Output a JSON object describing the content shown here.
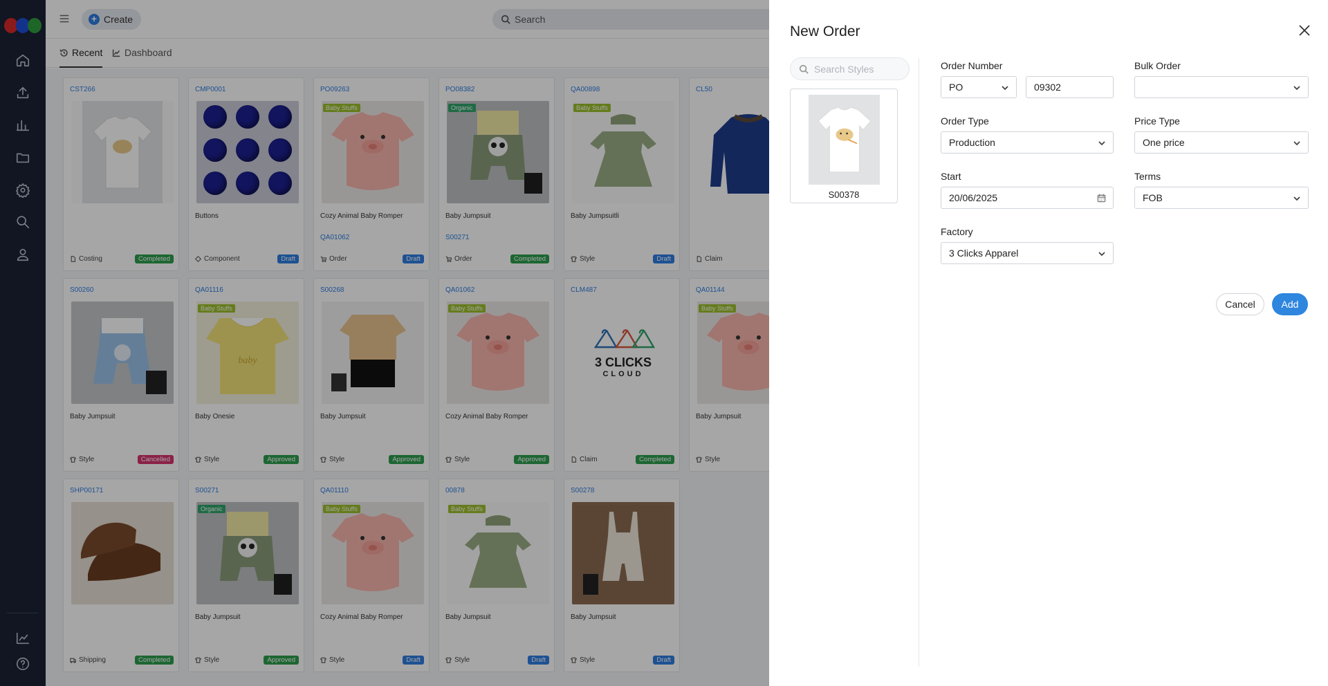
{
  "app": {
    "create_label": "Create",
    "search_placeholder": "Search"
  },
  "tabs": [
    {
      "label": "Recent",
      "icon": "history-icon"
    },
    {
      "label": "Dashboard",
      "icon": "chart-icon"
    }
  ],
  "cards": [
    {
      "code": "CST266",
      "name": "",
      "link": "",
      "type": "Costing",
      "type_icon": "file-icon",
      "status": "Completed",
      "status_color": "#2d9d4d",
      "tag": "",
      "image": "tshirt"
    },
    {
      "code": "CMP0001",
      "name": "Buttons",
      "link": "",
      "type": "Component",
      "type_icon": "diamond-icon",
      "status": "Draft",
      "status_color": "#2e7de0",
      "tag": "",
      "image": "buttons"
    },
    {
      "code": "PO09263",
      "name": "Cozy Animal Baby Romper",
      "link": "QA01062",
      "type": "Order",
      "type_icon": "cart-icon",
      "status": "Draft",
      "status_color": "#2e7de0",
      "tag": "Baby Stuffs",
      "tag_color": "#9bbf2b",
      "image": "pig"
    },
    {
      "code": "PO08382",
      "name": "Baby Jumpsuit",
      "link": "S00271",
      "type": "Order",
      "type_icon": "cart-icon",
      "status": "Completed",
      "status_color": "#2d9d4d",
      "tag": "Organic",
      "tag_color": "#2fa36b",
      "image": "panda"
    },
    {
      "code": "QA00898",
      "name": "Baby Jumpsuitli",
      "link": "",
      "type": "Style",
      "type_icon": "shirt-icon",
      "status": "Draft",
      "status_color": "#2e7de0",
      "tag": "Baby Stuffs",
      "tag_color": "#9bbf2b",
      "image": "dress"
    },
    {
      "code": "CL50",
      "name": "",
      "link": "",
      "type": "Claim",
      "type_icon": "file-icon",
      "status": "",
      "status_color": "",
      "tag": "",
      "image": "jacket"
    },
    {
      "code": "S00260",
      "name": "Baby Jumpsuit",
      "link": "",
      "type": "Style",
      "type_icon": "shirt-icon",
      "status": "Cancelled",
      "status_color": "#d6336c",
      "tag": "",
      "image": "blue"
    },
    {
      "code": "QA01116",
      "name": "Baby Onesie",
      "link": "",
      "type": "Style",
      "type_icon": "shirt-icon",
      "status": "Approved",
      "status_color": "#2d9d4d",
      "tag": "Baby Stuffs",
      "tag_color": "#9bbf2b",
      "image": "yellow"
    },
    {
      "code": "S00268",
      "name": "Baby Jumpsuit",
      "link": "",
      "type": "Style",
      "type_icon": "shirt-icon",
      "status": "Approved",
      "status_color": "#2d9d4d",
      "tag": "",
      "image": "dino"
    },
    {
      "code": "QA01062",
      "name": "Cozy Animal Baby Romper",
      "link": "",
      "type": "Style",
      "type_icon": "shirt-icon",
      "status": "Approved",
      "status_color": "#2d9d4d",
      "tag": "Baby Stuffs",
      "tag_color": "#9bbf2b",
      "image": "pig"
    },
    {
      "code": "CLM487",
      "name": "",
      "link": "",
      "type": "Claim",
      "type_icon": "file-icon",
      "status": "Completed",
      "status_color": "#2d9d4d",
      "tag": "",
      "image": "logo",
      "logo_text1": "3 CLICKS",
      "logo_text2": "CLOUD"
    },
    {
      "code": "QA01144",
      "name": "Baby Jumpsuit",
      "link": "",
      "type": "Style",
      "type_icon": "shirt-icon",
      "status": "",
      "status_color": "",
      "tag": "Baby Stuffs",
      "tag_color": "#9bbf2b",
      "image": "pig"
    },
    {
      "code": "SHP00171",
      "name": "",
      "link": "",
      "type": "Shipping",
      "type_icon": "truck-icon",
      "status": "Completed",
      "status_color": "#2d9d4d",
      "tag": "",
      "image": "shoes"
    },
    {
      "code": "S00271",
      "name": "Baby Jumpsuit",
      "link": "",
      "type": "Style",
      "type_icon": "shirt-icon",
      "status": "Approved",
      "status_color": "#2d9d4d",
      "tag": "Organic",
      "tag_color": "#2fa36b",
      "image": "panda"
    },
    {
      "code": "QA01110",
      "name": "Cozy Animal Baby Romper",
      "link": "",
      "type": "Style",
      "type_icon": "shirt-icon",
      "status": "Draft",
      "status_color": "#2e7de0",
      "tag": "Baby Stuffs",
      "tag_color": "#9bbf2b",
      "image": "pig"
    },
    {
      "code": "00878",
      "name": "Baby Jumpsuit",
      "link": "",
      "type": "Style",
      "type_icon": "shirt-icon",
      "status": "Draft",
      "status_color": "#2e7de0",
      "tag": "Baby Stuffs",
      "tag_color": "#9bbf2b",
      "image": "dress"
    },
    {
      "code": "S00278",
      "name": "Baby Jumpsuit",
      "link": "",
      "type": "Style",
      "type_icon": "shirt-icon",
      "status": "Draft",
      "status_color": "#2e7de0",
      "tag": "",
      "image": "overalls"
    }
  ],
  "drawer": {
    "title": "New Order",
    "style_search_placeholder": "Search Styles",
    "selected_style": {
      "code": "S00378"
    },
    "order_number": {
      "label": "Order Number",
      "prefix": "PO",
      "value": "09302"
    },
    "bulk_order": {
      "label": "Bulk Order",
      "value": ""
    },
    "order_type": {
      "label": "Order Type",
      "value": "Production"
    },
    "price_type": {
      "label": "Price Type",
      "value": "One price"
    },
    "start": {
      "label": "Start",
      "value": "20/06/2025"
    },
    "terms": {
      "label": "Terms",
      "value": "FOB"
    },
    "factory": {
      "label": "Factory",
      "value": "3 Clicks Apparel"
    },
    "cancel_label": "Cancel",
    "add_label": "Add"
  },
  "colors": {
    "accent": "#2e86de",
    "rail": "#1b2235"
  }
}
